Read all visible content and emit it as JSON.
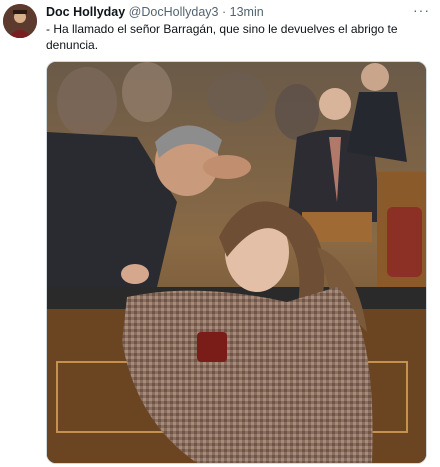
{
  "tweet": {
    "author_name": "Doc Hollyday",
    "author_handle": "@DocHollyday3",
    "separator": "·",
    "time": "13min",
    "more_icon": "more-horizontal-icon",
    "text": "- Ha llamado el señor Barragán, que sino le devuelves el abrigo te denuncia.",
    "media_description_icon": "photo"
  },
  "colors": {
    "text_primary": "#0f1419",
    "text_secondary": "#536471",
    "border": "#cfd9de"
  }
}
